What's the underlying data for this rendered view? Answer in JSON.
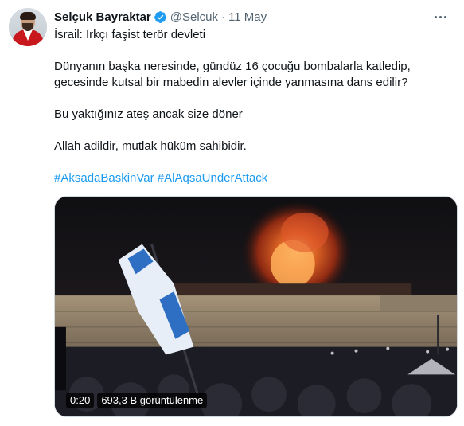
{
  "author": {
    "name": "Selçuk Bayraktar",
    "handle": "@Selcuk",
    "separator": "·",
    "date": "11 May"
  },
  "tweet": {
    "lines": [
      "İsrail: Irkçı faşist terör devleti",
      "Dünyanın başka neresinde, gündüz 16 çocuğu bombalarla katledip,",
      "gecesinde kutsal bir mabedin alevler içinde yanmasına dans edilir?",
      "Bu yaktığınız ateş ancak size döner",
      "Allah adildir, mutlak hüküm sahibidir."
    ],
    "hashtags": [
      "#AksadaBaskinVar",
      "#AlAqsaUnderAttack"
    ]
  },
  "video": {
    "duration": "0:20",
    "views": "693,3 B görüntülenme"
  },
  "colors": {
    "link": "#1d9bf0",
    "verified": "#1d9bf0",
    "secondary_text": "#536471"
  },
  "icons": [
    "verified-badge-icon",
    "more-options-icon"
  ]
}
